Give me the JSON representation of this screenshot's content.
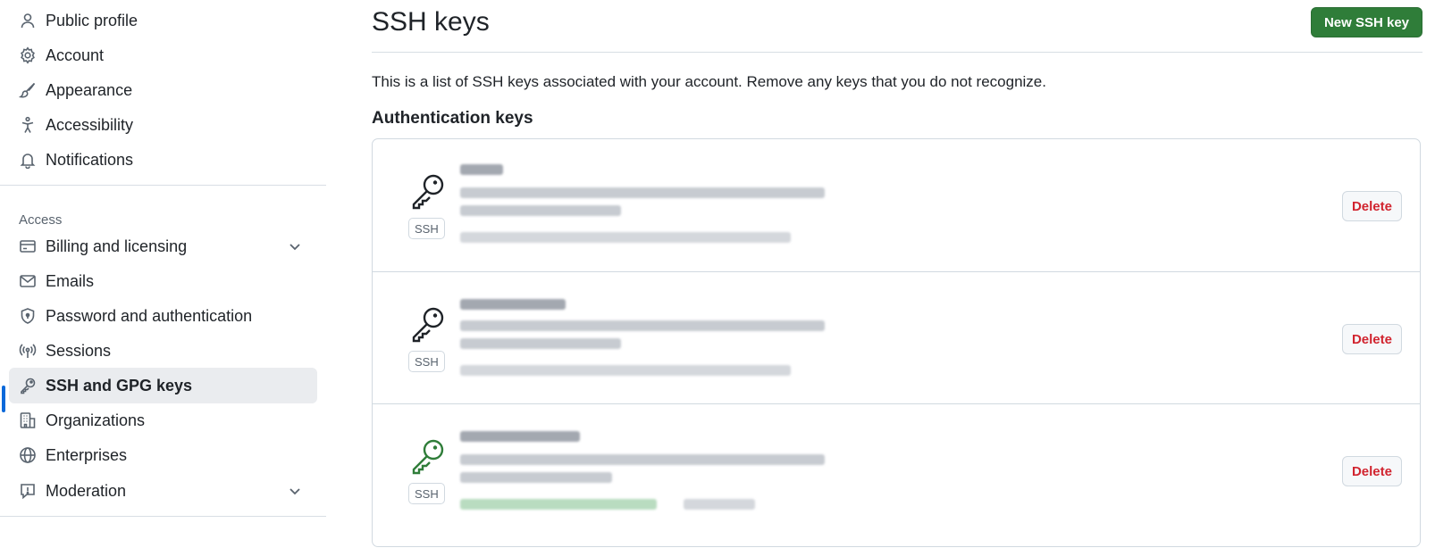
{
  "sidebar": {
    "top_items": [
      {
        "label": "Public profile",
        "icon": "person-icon"
      },
      {
        "label": "Account",
        "icon": "gear-icon"
      },
      {
        "label": "Appearance",
        "icon": "paintbrush-icon"
      },
      {
        "label": "Accessibility",
        "icon": "accessibility-icon"
      },
      {
        "label": "Notifications",
        "icon": "bell-icon"
      }
    ],
    "access_label": "Access",
    "access_items": [
      {
        "label": "Billing and licensing",
        "icon": "credit-card-icon"
      },
      {
        "label": "Emails",
        "icon": "mail-icon"
      },
      {
        "label": "Password and authentication",
        "icon": "shield-lock-icon"
      },
      {
        "label": "Sessions",
        "icon": "broadcast-icon"
      },
      {
        "label": "SSH and GPG keys",
        "icon": "key-icon"
      },
      {
        "label": "Organizations",
        "icon": "organization-icon"
      },
      {
        "label": "Enterprises",
        "icon": "globe-icon"
      },
      {
        "label": "Moderation",
        "icon": "report-icon"
      }
    ]
  },
  "main": {
    "title": "SSH keys",
    "new_button": "New SSH key",
    "description": "This is a list of SSH keys associated with your account. Remove any keys that you do not recognize.",
    "section_heading": "Authentication keys",
    "keys": [
      {
        "badge": "SSH",
        "delete_label": "Delete",
        "icon_color": "#1f2328"
      },
      {
        "badge": "SSH",
        "delete_label": "Delete",
        "icon_color": "#1f2328"
      },
      {
        "badge": "SSH",
        "delete_label": "Delete",
        "icon_color": "#2f7d39"
      }
    ]
  },
  "colors": {
    "primary_button": "#2f7d39",
    "danger_text": "#d1242f",
    "active_indicator": "#0969da",
    "active_item_bg": "#eaecef"
  }
}
